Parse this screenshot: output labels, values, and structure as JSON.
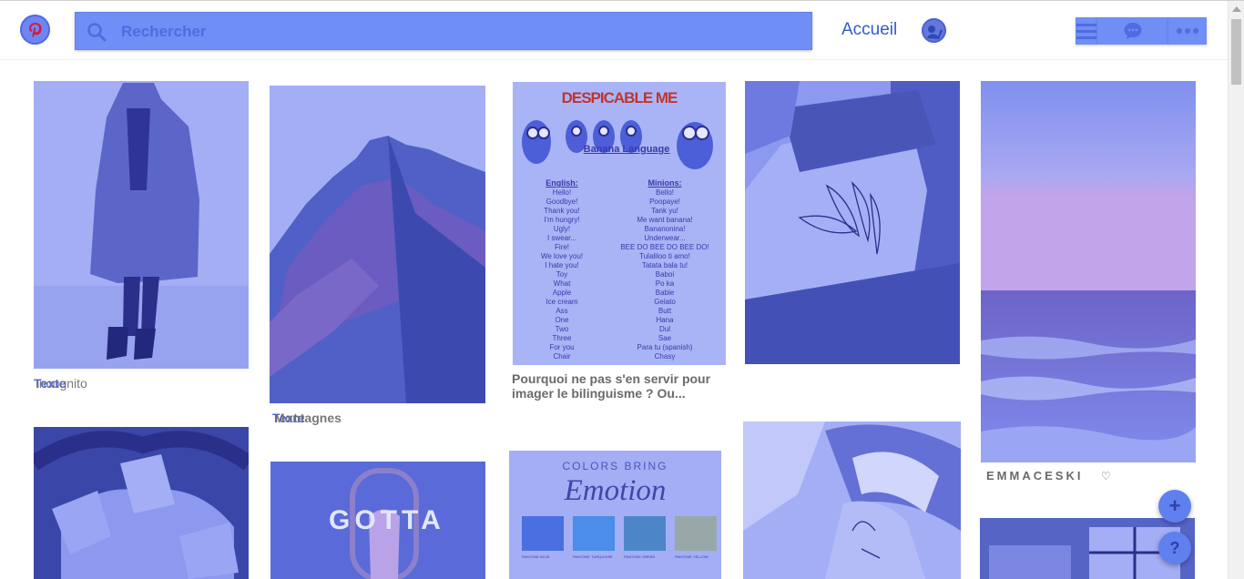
{
  "header": {
    "search_placeholder": "Rechercher",
    "home_label": "Accueil",
    "logo_icon": "pinterest-logo-icon",
    "icons": [
      "search-icon",
      "user-avatar-icon",
      "menu-icon",
      "messages-icon",
      "more-icon"
    ]
  },
  "pins": {
    "pin1": {
      "tag": "Texte",
      "caption": "Incognito"
    },
    "pin2": {
      "tag": "Texte",
      "caption": "Montagnes"
    },
    "pin3": {
      "title": "DESPICABLE ME",
      "subtitle": "Banana Language",
      "col_left_head": "English:",
      "col_right_head": "Minions:",
      "english": [
        "Hello!",
        "Goodbye!",
        "Thank you!",
        "I'm hungry!",
        "Ugly!",
        "I swear...",
        "Fire!",
        "We love you!",
        "I hate you!",
        "Toy",
        "What",
        "Apple",
        "Ice cream",
        "Ass",
        "One",
        "Two",
        "Three",
        "For you",
        "Chair"
      ],
      "minions": [
        "Bello!",
        "Poopaye!",
        "Tank yu!",
        "Me want banana!",
        "Bananonina!",
        "Underwear...",
        "BEE DO BEE DO BEE DO!",
        "Tulaliloo ti amo!",
        "Tatata bala tu!",
        "Baboi",
        "Po ka",
        "Bable",
        "Gelato",
        "Butt",
        "Hana",
        "Dul",
        "Sae",
        "Para tu (spanish)",
        "Chasy"
      ],
      "caption": "Pourquoi ne pas s'en servir pour imager le bilinguisme ? Ou..."
    },
    "pin5": {
      "caption": "EMMACESKI",
      "heart": "♡"
    },
    "pin8": {
      "line1": "COLORS BRING",
      "line2": "Emotion",
      "swatches": [
        "PANTONE BLUE",
        "PANTONE TURQUOISE",
        "PANTONE GREEN",
        "PANTONE YELLOW"
      ]
    },
    "pin7": {
      "text": "GOTTA"
    }
  },
  "fabs": {
    "add": "+",
    "help": "?"
  },
  "colors": {
    "overlay": "#6f8ef6",
    "accent": "#2f5ec8"
  }
}
